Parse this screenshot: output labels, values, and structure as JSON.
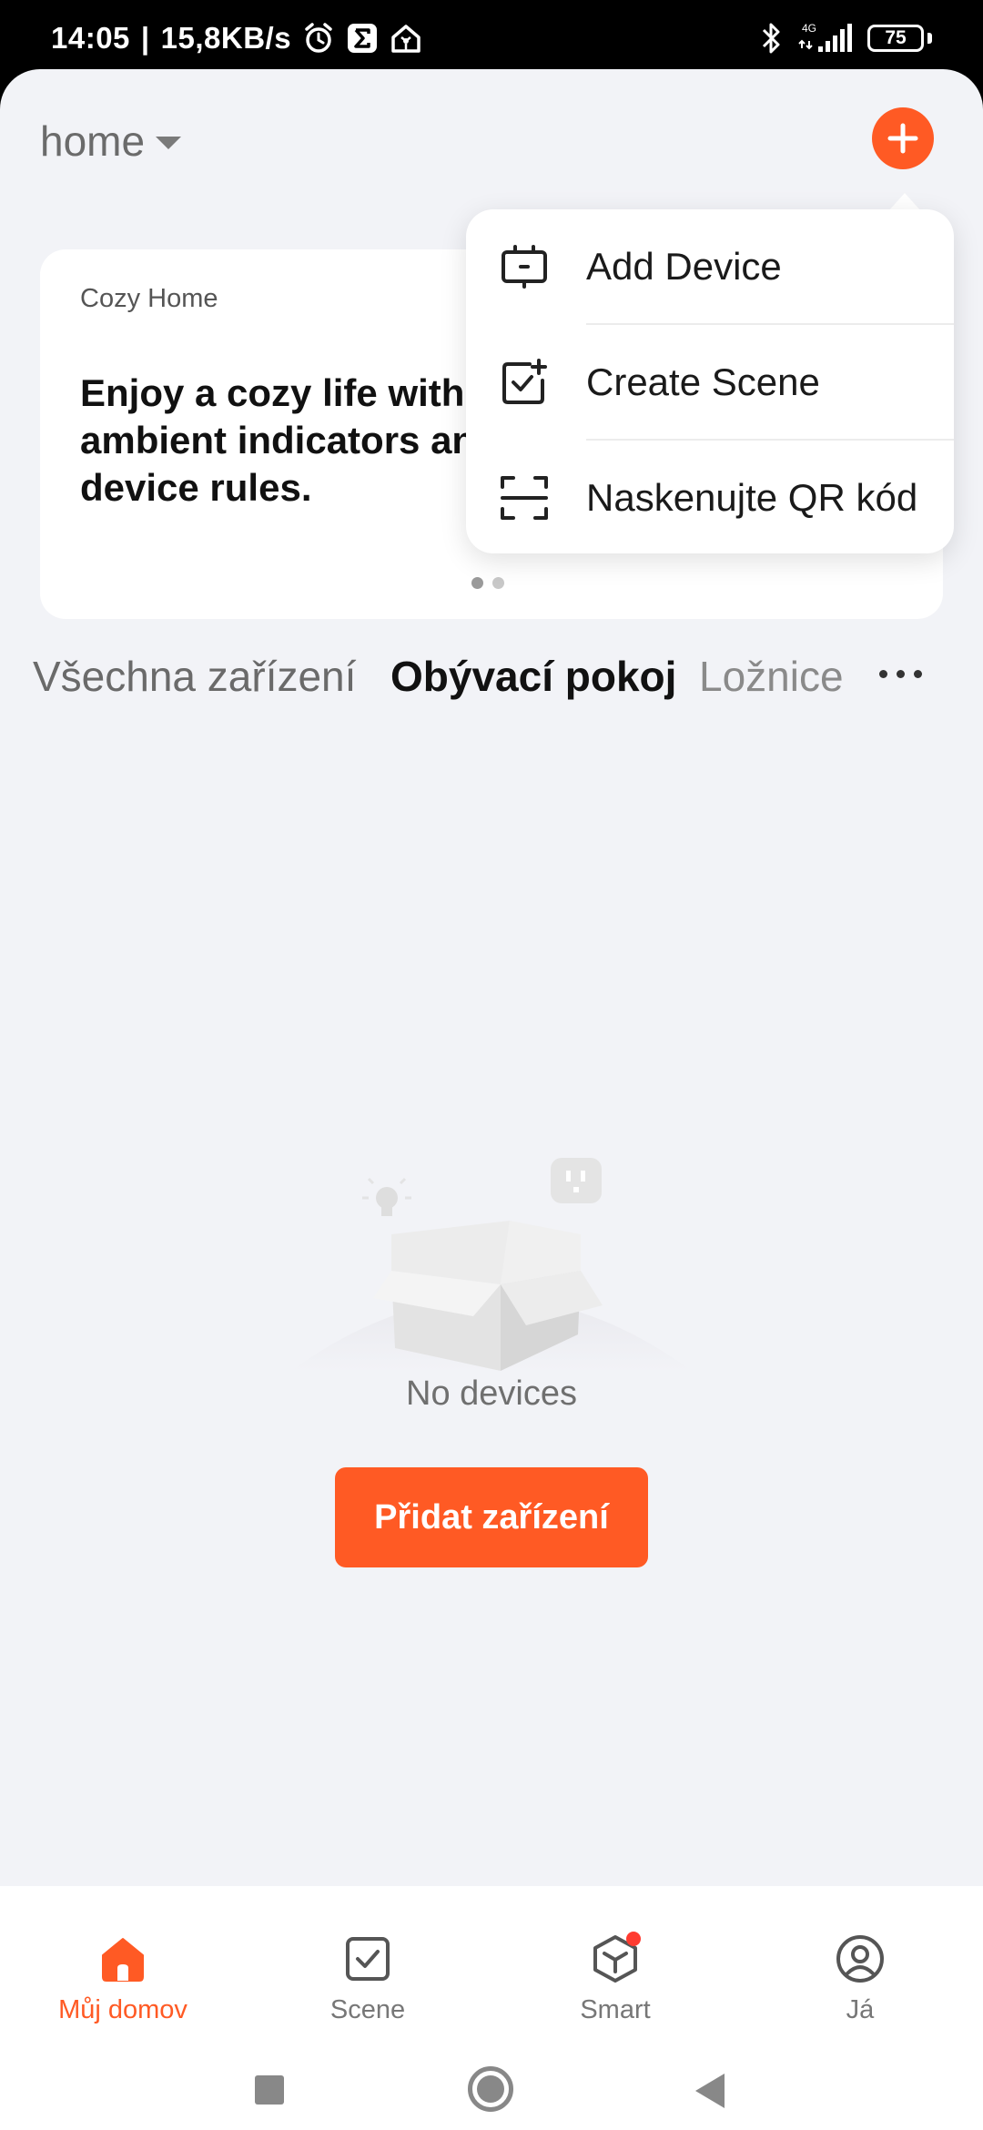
{
  "status_bar": {
    "time": "14:05",
    "separator": "|",
    "speed": "15,8KB/s",
    "network": "4G",
    "battery": "75",
    "battery_level": 0.75,
    "icons": [
      "alarm-icon",
      "sigma-app-icon",
      "home-app-icon",
      "bluetooth-icon",
      "signal-icon",
      "battery-icon"
    ]
  },
  "header": {
    "home_name": "home",
    "add_icon": "plus-icon"
  },
  "banner": {
    "subtitle": "Cozy Home",
    "title": "Enjoy a cozy life with ambient indicators and device rules.",
    "page_count": 2,
    "active_page": 1
  },
  "popup_menu": {
    "items": [
      {
        "label": "Add Device",
        "icon": "add-device-icon"
      },
      {
        "label": "Create Scene",
        "icon": "create-scene-icon"
      },
      {
        "label": "Naskenujte QR kód",
        "icon": "scan-qr-icon"
      }
    ]
  },
  "tabs": {
    "items": [
      {
        "label": "Všechna zařízení",
        "active": false
      },
      {
        "label": "Obývací pokoj",
        "active": true
      },
      {
        "label": "Ložnice",
        "active": false
      }
    ],
    "more_icon": "more-icon"
  },
  "empty_state": {
    "text": "No devices",
    "button_label": "Přidat zařízení"
  },
  "bottom_nav": {
    "items": [
      {
        "label": "Můj domov",
        "icon": "home-icon",
        "active": true
      },
      {
        "label": "Scene",
        "icon": "scene-icon",
        "active": false
      },
      {
        "label": "Smart",
        "icon": "smart-icon",
        "active": false,
        "badge": true
      },
      {
        "label": "Já",
        "icon": "profile-icon",
        "active": false
      }
    ]
  },
  "colors": {
    "accent": "#ff5a24",
    "background": "#f2f3f7",
    "badge": "#ff3b30"
  }
}
